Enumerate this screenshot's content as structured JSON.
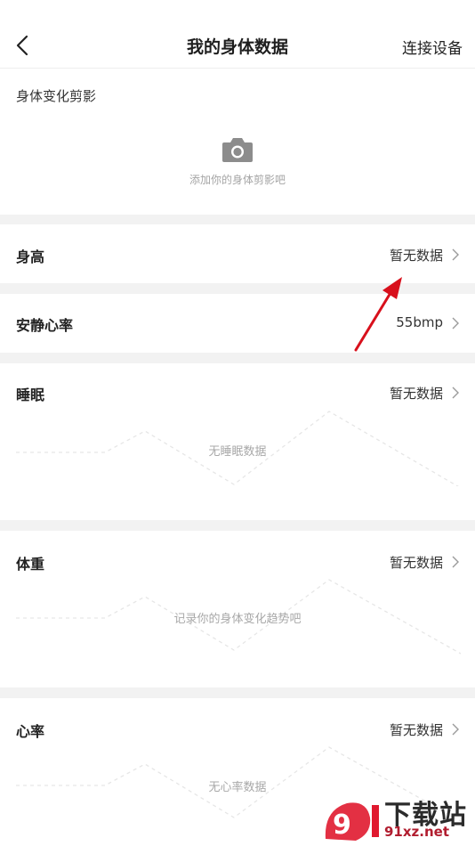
{
  "header": {
    "title": "我的身体数据",
    "connect_label": "连接设备"
  },
  "photo": {
    "title": "身体变化剪影",
    "hint": "添加你的身体剪影吧"
  },
  "rows": {
    "height": {
      "title": "身高",
      "value": "暂无数据"
    },
    "resting_hr": {
      "title": "安静心率",
      "value": "55bmp"
    },
    "sleep": {
      "title": "睡眠",
      "value": "暂无数据",
      "empty": "无睡眠数据"
    },
    "weight": {
      "title": "体重",
      "value": "暂无数据",
      "empty": "记录你的身体变化趋势吧"
    },
    "heart_rate": {
      "title": "心率",
      "value": "暂无数据",
      "empty": "无心率数据"
    }
  },
  "watermark": {
    "brand": "下载站",
    "site": "91xz.net"
  },
  "colors": {
    "arrow": "#d8101c",
    "accent_red": "#e0192f"
  }
}
